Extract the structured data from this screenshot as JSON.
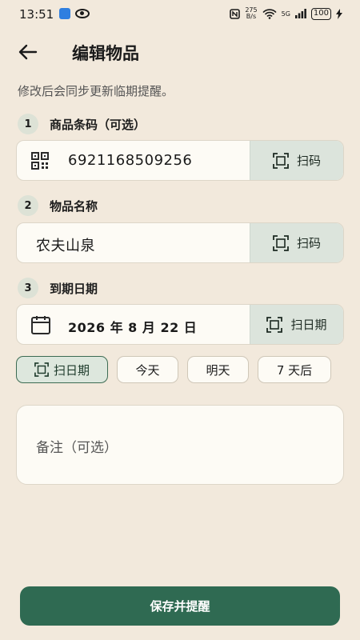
{
  "status_bar": {
    "time": "13:51",
    "net_speed_value": "275",
    "net_speed_unit": "B/s",
    "battery": "100",
    "signal": "5G"
  },
  "header": {
    "title": "编辑物品"
  },
  "hint": "修改后会同步更新临期提醒。",
  "steps": [
    {
      "num": "1",
      "label": "商品条码（可选）"
    },
    {
      "num": "2",
      "label": "物品名称"
    },
    {
      "num": "3",
      "label": "到期日期"
    }
  ],
  "barcode": {
    "value": "6921168509256",
    "scan_label": "扫码"
  },
  "name": {
    "value": "农夫山泉",
    "scan_label": "扫码"
  },
  "expiry": {
    "value": "2026 年 8 月 22 日",
    "scan_label": "扫日期"
  },
  "chips": [
    {
      "label": "扫日期",
      "active": true
    },
    {
      "label": "今天",
      "active": false
    },
    {
      "label": "明天",
      "active": false
    },
    {
      "label": "7 天后",
      "active": false
    }
  ],
  "notes": {
    "placeholder": "备注（可选）"
  },
  "save_label": "保存并提醒",
  "colors": {
    "background": "#f2e9dc",
    "primary": "#2f6a52",
    "scan_button_bg": "#dce4dc",
    "field_bg": "#fdfbf5"
  }
}
